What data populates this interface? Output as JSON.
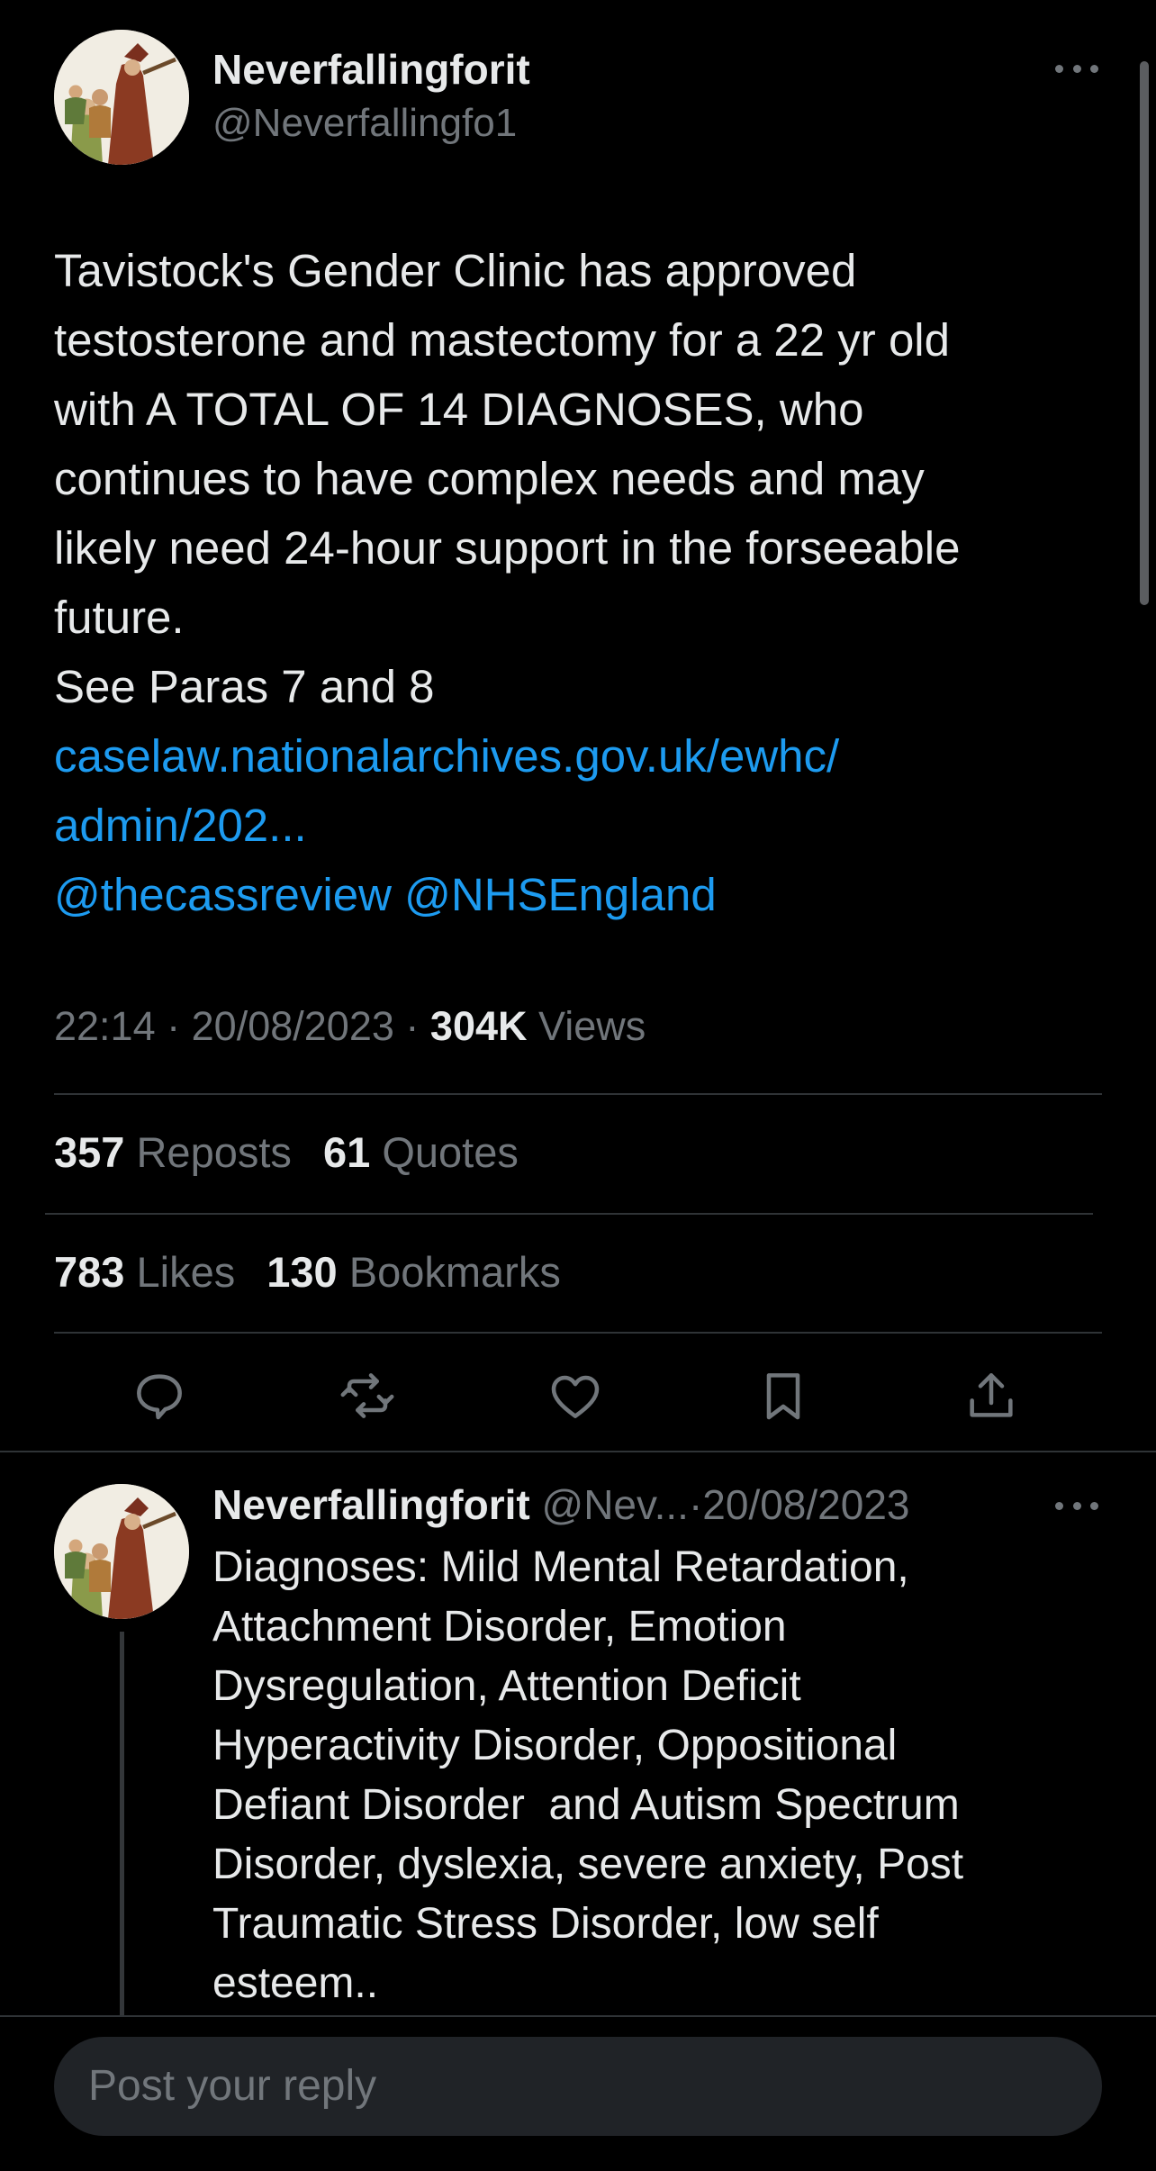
{
  "colors": {
    "background": "#000000",
    "text": "#e7e9ea",
    "secondary_text": "#71767b",
    "link": "#1d9bf0",
    "divider": "#2f3336",
    "input_bg": "#202327"
  },
  "main_tweet": {
    "author": {
      "display_name": "Neverfallingforit",
      "handle": "@Neverfallingfo1",
      "avatar_icon": "avatar-image"
    },
    "more_icon": "more-horizontal-icon",
    "body_lines": [
      "Tavistock's Gender Clinic has approved",
      "testosterone and mastectomy for a 22 yr old",
      "with A TOTAL OF 14 DIAGNOSES, who",
      "continues to have complex needs and may",
      "likely need 24-hour support in the forseeable",
      "future.",
      "See Paras 7 and 8"
    ],
    "link_lines": [
      "caselaw.nationalarchives.gov.uk/ewhc/",
      "admin/202..."
    ],
    "mentions": [
      "@thecassreview",
      "@NHSEngland"
    ],
    "time": "22:14",
    "date": "20/08/2023",
    "separator": "·",
    "views_count": "304K",
    "views_label": "Views"
  },
  "stats": {
    "reposts_count": "357",
    "reposts_label": "Reposts",
    "quotes_count": "61",
    "quotes_label": "Quotes",
    "likes_count": "783",
    "likes_label": "Likes",
    "bookmarks_count": "130",
    "bookmarks_label": "Bookmarks"
  },
  "actions": [
    "reply-icon",
    "repost-icon",
    "like-icon",
    "bookmark-icon",
    "share-icon"
  ],
  "reply": {
    "display_name": "Neverfallingforit",
    "handle": "@Nev...",
    "separator": "·",
    "date": "20/08/2023",
    "body_lines": [
      "Diagnoses: Mild Mental Retardation,",
      "Attachment Disorder, Emotion",
      "Dysregulation, Attention Deficit",
      "Hyperactivity Disorder, Oppositional",
      "Defiant Disorder  and Autism Spectrum",
      "Disorder, dyslexia, severe anxiety, Post",
      "Traumatic Stress Disorder, low self",
      "esteem.."
    ]
  },
  "composer": {
    "placeholder": "Post your reply"
  }
}
